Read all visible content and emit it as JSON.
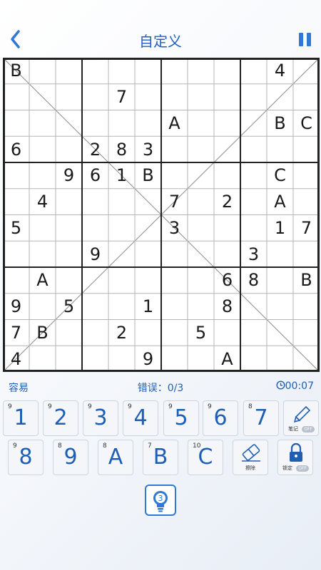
{
  "header": {
    "title": "自定义"
  },
  "board": {
    "size": 12,
    "cells": [
      [
        "B",
        "",
        "",
        "",
        "",
        "",
        "",
        "",
        "",
        "",
        "4",
        ""
      ],
      [
        "",
        "",
        "",
        "",
        "7",
        "",
        "",
        "",
        "",
        "",
        "",
        ""
      ],
      [
        "",
        "",
        "",
        "",
        "",
        "",
        "A",
        "",
        "",
        "",
        "B",
        "C"
      ],
      [
        "6",
        "",
        "",
        "2",
        "8",
        "3",
        "",
        "",
        "",
        "",
        "",
        ""
      ],
      [
        "",
        "",
        "9",
        "6",
        "1",
        "B",
        "",
        "",
        "",
        "",
        "C",
        ""
      ],
      [
        "",
        "4",
        "",
        "",
        "",
        "",
        "7",
        "",
        "2",
        "",
        "A",
        ""
      ],
      [
        "5",
        "",
        "",
        "",
        "",
        "",
        "3",
        "",
        "",
        "",
        "1",
        "7"
      ],
      [
        "",
        "",
        "",
        "9",
        "",
        "",
        "",
        "",
        "",
        "3",
        "",
        ""
      ],
      [
        "",
        "A",
        "",
        "",
        "",
        "",
        "",
        "",
        "6",
        "8",
        "",
        "B"
      ],
      [
        "9",
        "",
        "5",
        "",
        "",
        "1",
        "",
        "",
        "8",
        "",
        "",
        ""
      ],
      [
        "7",
        "B",
        "",
        "",
        "2",
        "",
        "",
        "5",
        "",
        "",
        "",
        ""
      ],
      [
        "4",
        "",
        "",
        "",
        "",
        "9",
        "",
        "",
        "A",
        "",
        "",
        ""
      ]
    ]
  },
  "status": {
    "difficulty": "容易",
    "errors": "错误：0/3",
    "timer": "00:07"
  },
  "keypad": [
    {
      "label": "1",
      "count": "9"
    },
    {
      "label": "2",
      "count": "9"
    },
    {
      "label": "3",
      "count": "9"
    },
    {
      "label": "4",
      "count": "9"
    },
    {
      "label": "5",
      "count": "9"
    },
    {
      "label": "6",
      "count": "9"
    },
    {
      "label": "7",
      "count": "8"
    },
    {
      "label": "8",
      "count": "9"
    },
    {
      "label": "9",
      "count": "8"
    },
    {
      "label": "A",
      "count": "8"
    },
    {
      "label": "B",
      "count": "7"
    },
    {
      "label": "C",
      "count": "10"
    }
  ],
  "tools": {
    "notes": {
      "label": "笔记",
      "state": "OFF"
    },
    "erase": {
      "label": "擦除"
    },
    "lock": {
      "label": "锁定",
      "state": "OFF"
    }
  },
  "hint": {
    "count": "3"
  },
  "colors": {
    "accent": "#2f78d4",
    "text": "#1e5fb4"
  }
}
